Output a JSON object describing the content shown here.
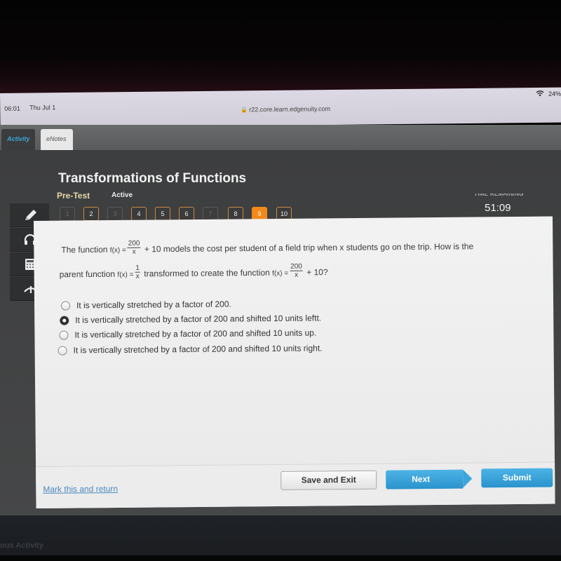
{
  "status_bar": {
    "time": "06:01",
    "date": "Thu Jul 1",
    "url": "r22.core.learn.edgenuity.com",
    "wifi_icon": "wifi-icon",
    "battery": "24%"
  },
  "tabs": [
    {
      "label": "Activity",
      "active": true
    },
    {
      "label": "eNotes",
      "active": false
    }
  ],
  "header": {
    "title": "Transformations of Functions",
    "type": "Pre-Test",
    "state": "Active",
    "time_label": "TIME REMAINING",
    "time_value": "51:09"
  },
  "question_nav": [
    {
      "label": "1",
      "state": "skip"
    },
    {
      "label": "2",
      "state": "done"
    },
    {
      "label": "3",
      "state": "skip"
    },
    {
      "label": "4",
      "state": "done"
    },
    {
      "label": "5",
      "state": "done"
    },
    {
      "label": "6",
      "state": "done"
    },
    {
      "label": "7",
      "state": "skip"
    },
    {
      "label": "8",
      "state": "done"
    },
    {
      "label": "9",
      "state": "current"
    },
    {
      "label": "10",
      "state": "done"
    }
  ],
  "tools": [
    {
      "name": "pencil-icon"
    },
    {
      "name": "headphones-icon"
    },
    {
      "name": "calculator-icon"
    },
    {
      "name": "collapse-up-icon"
    }
  ],
  "question": {
    "line1_prefix": "The function",
    "line1_fx": "f(x) =",
    "line1_num": "200",
    "line1_den": "x",
    "line1_suffix": "+ 10 models the cost per student of a field trip when x students go on the trip. How is the",
    "line2_prefix": "parent function",
    "line2_fx": "f(x) =",
    "line2_num": "1",
    "line2_den": "x",
    "line2_mid": "transformed to create the function",
    "line2_fx2": "f(x) =",
    "line2_num2": "200",
    "line2_den2": "x",
    "line2_suffix": "+ 10?"
  },
  "choices": [
    {
      "label": "It is vertically stretched by a factor of 200.",
      "selected": false
    },
    {
      "label": "It is vertically stretched by a factor of 200 and shifted 10 units leftt.",
      "selected": true
    },
    {
      "label": "It is vertically stretched by a factor of 200 and shifted 10 units up.",
      "selected": false
    },
    {
      "label": "It is vertically stretched by a factor of 200 and shifted 10 units right.",
      "selected": false
    }
  ],
  "footer": {
    "mark_link": "Mark this and return",
    "save_exit": "Save and Exit",
    "next": "Next",
    "submit": "Submit"
  },
  "bottom": {
    "prev_activity": "ous Activity"
  },
  "colors": {
    "accent_orange": "#f2891a",
    "accent_blue": "#3aa5da",
    "link_blue": "#4b8abf"
  }
}
